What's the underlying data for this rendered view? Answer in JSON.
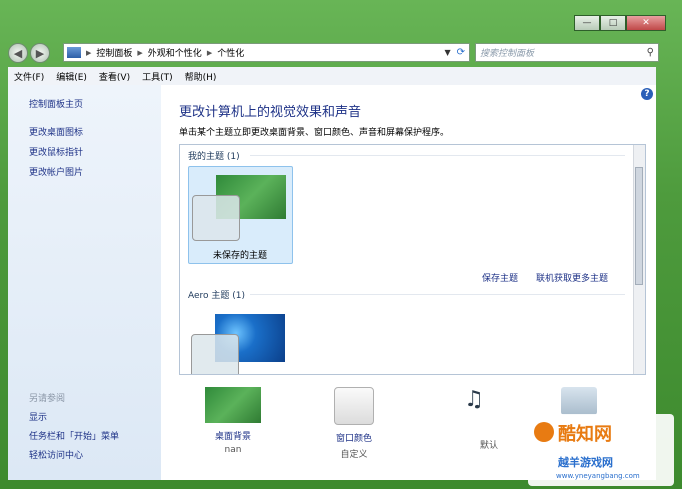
{
  "window": {
    "buttons": {
      "minimize": "—",
      "maximize": "□",
      "close": "✕"
    }
  },
  "address": {
    "segments": [
      "控制面板",
      "外观和个性化",
      "个性化"
    ],
    "search_placeholder": "搜索控制面板"
  },
  "menu": [
    "文件(F)",
    "编辑(E)",
    "查看(V)",
    "工具(T)",
    "帮助(H)"
  ],
  "sidebar": {
    "home": "控制面板主页",
    "links": [
      "更改桌面图标",
      "更改鼠标指针",
      "更改帐户图片"
    ],
    "see_also_label": "另请参阅",
    "see_also": [
      "显示",
      "任务栏和「开始」菜单",
      "轻松访问中心"
    ]
  },
  "main": {
    "title": "更改计算机上的视觉效果和声音",
    "description": "单击某个主题立即更改桌面背景、窗口颜色、声音和屏幕保护程序。",
    "my_themes_header": "我的主题 (1)",
    "unsaved_theme": "未保存的主题",
    "save_theme": "保存主题",
    "get_more": "联机获取更多主题",
    "aero_header": "Aero 主题 (1)"
  },
  "bottom": {
    "background_label": "桌面背景",
    "background_value": "nan",
    "color_label": "窗口颜色",
    "color_value": "自定义",
    "sound_value": "默认"
  },
  "watermark": {
    "brand": "酷知网",
    "line2": "越羊游戏网",
    "url": "www.yneyangbang.com"
  },
  "colors": {
    "accent": "#1e3287",
    "frame": "#4e9b3d",
    "selection": "#d9ecfb"
  }
}
